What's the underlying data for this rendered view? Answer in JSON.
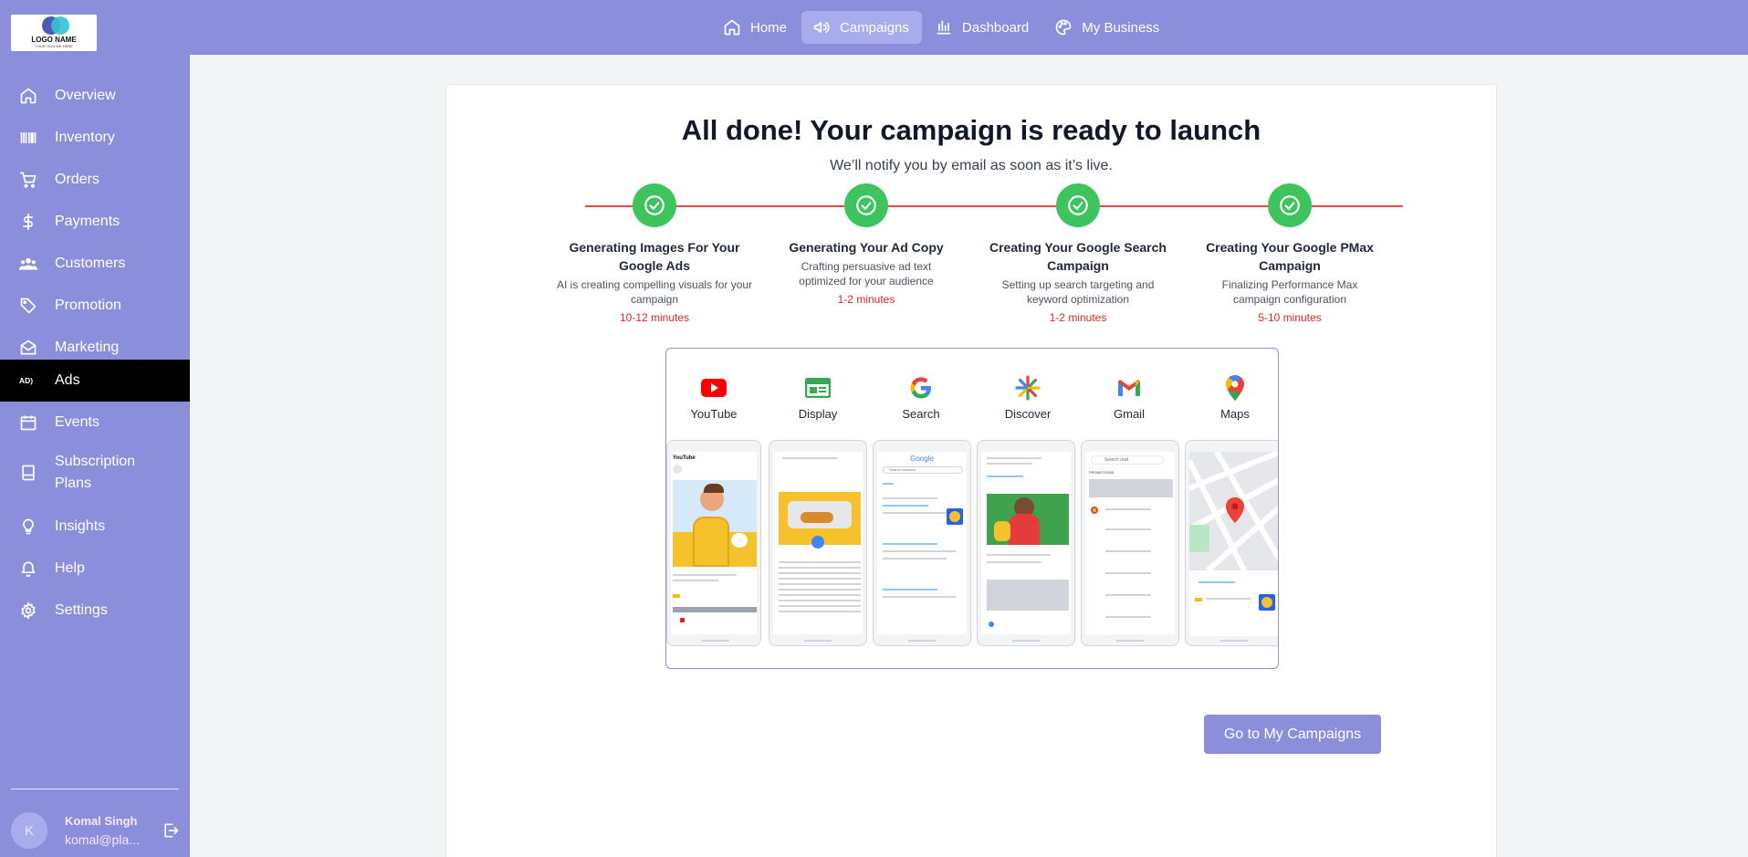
{
  "logo": {
    "name": "LOGO NAME",
    "tagline": "YOUR TAGLINE HERE"
  },
  "topnav": [
    {
      "label": "Home",
      "icon": "home-icon",
      "active": false
    },
    {
      "label": "Campaigns",
      "icon": "megaphone-icon",
      "active": true
    },
    {
      "label": "Dashboard",
      "icon": "bar-chart-icon",
      "active": false
    },
    {
      "label": "My Business",
      "icon": "palette-icon",
      "active": false
    }
  ],
  "sidebar": {
    "items": [
      {
        "label": "Overview",
        "icon": "home-icon"
      },
      {
        "label": "Inventory",
        "icon": "barcode-icon"
      },
      {
        "label": "Orders",
        "icon": "cart-icon"
      },
      {
        "label": "Payments",
        "icon": "dollar-icon"
      },
      {
        "label": "Customers",
        "icon": "users-icon"
      },
      {
        "label": "Promotion",
        "icon": "tag-icon"
      },
      {
        "label": "Marketing",
        "icon": "mail-icon"
      },
      {
        "label": "Ads",
        "icon": "ads-icon",
        "active": true
      },
      {
        "label": "Events",
        "icon": "calendar-icon"
      },
      {
        "label": "Subscription Plans",
        "icon": "book-icon"
      },
      {
        "label": "Insights",
        "icon": "lightbulb-icon"
      },
      {
        "label": "Help",
        "icon": "bell-icon"
      },
      {
        "label": "Settings",
        "icon": "gear-icon"
      }
    ],
    "user": {
      "initial": "K",
      "name": "Komal Singh",
      "email": "komal@pla..."
    }
  },
  "main": {
    "title": "All done! Your campaign is ready to launch",
    "subtitle": "We’ll notify you by email as soon as it’s live.",
    "steps": [
      {
        "title": "Generating Images For Your Google Ads",
        "desc": "AI is creating compelling visuals for your campaign",
        "time": "10-12 minutes",
        "status": "complete"
      },
      {
        "title": "Generating Your Ad Copy",
        "desc": "Crafting persuasive ad text optimized for your audience",
        "time": "1-2 minutes",
        "status": "complete"
      },
      {
        "title": "Creating Your Google Search Campaign",
        "desc": "Setting up search targeting and keyword optimization",
        "time": "1-2 minutes",
        "status": "complete"
      },
      {
        "title": "Creating Your Google PMax Campaign",
        "desc": "Finalizing Performance Max campaign configuration",
        "time": "5-10 minutes",
        "status": "complete"
      }
    ],
    "channels": [
      {
        "label": "YouTube",
        "icon": "youtube-icon"
      },
      {
        "label": "Display",
        "icon": "display-icon"
      },
      {
        "label": "Search",
        "icon": "google-icon"
      },
      {
        "label": "Discover",
        "icon": "discover-icon"
      },
      {
        "label": "Gmail",
        "icon": "gmail-icon"
      },
      {
        "label": "Maps",
        "icon": "maps-icon"
      }
    ],
    "mockups": {
      "youtube_brand": "YouTube",
      "search_brand": "Google",
      "search_placeholder": "Search keyword",
      "gmail_search": "Search mail",
      "gmail_tab": "PROMOTIONS"
    },
    "cta_label": "Go to My Campaigns"
  },
  "colors": {
    "nav_bg": "#8b8fdb",
    "active_nav": "#a9acec",
    "success": "#3ec45c",
    "line": "#e8493f",
    "time": "#dc2626"
  }
}
